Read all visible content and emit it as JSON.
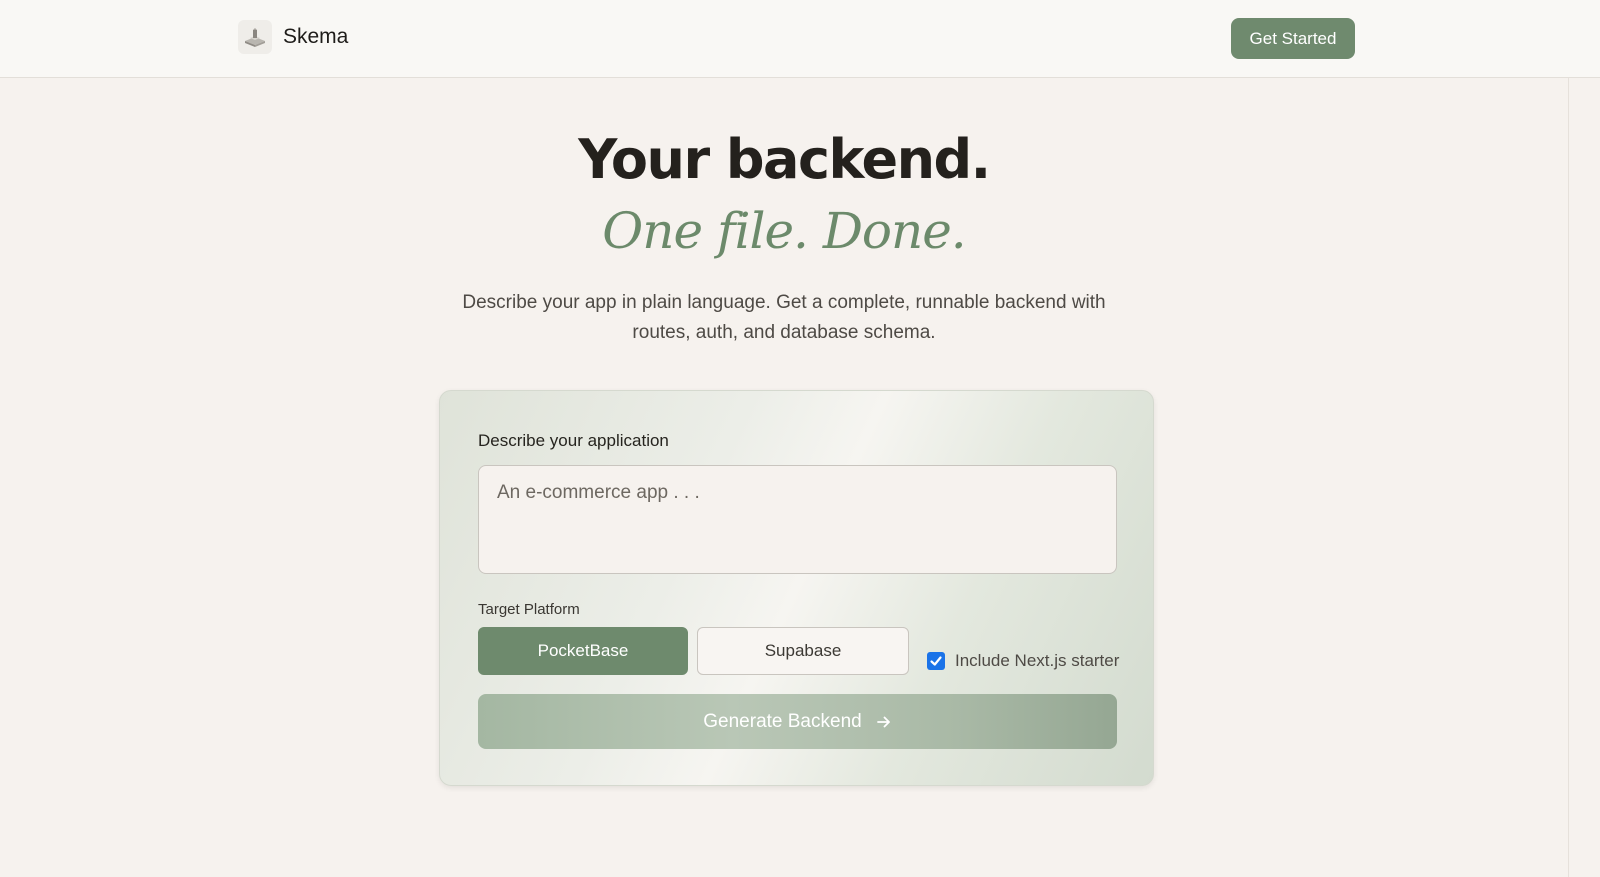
{
  "nav": {
    "brand_name": "Skema",
    "cta_label": "Get Started"
  },
  "hero": {
    "headline": "Your backend.",
    "tagline": "One file. Done.",
    "subtext": "Describe your app in plain language. Get a complete, runnable backend with routes, auth, and database schema."
  },
  "form": {
    "description_label": "Describe your application",
    "description_placeholder": "An e-commerce app . . .",
    "description_value": "",
    "platform_label": "Target Platform",
    "platforms": [
      {
        "label": "PocketBase",
        "selected": true
      },
      {
        "label": "Supabase",
        "selected": false
      }
    ],
    "nextjs_label": "Include Next.js starter",
    "nextjs_checked": true,
    "generate_label": "Generate Backend"
  },
  "colors": {
    "accent": "#6e8a6d",
    "tagline": "#6c8a6b",
    "background": "#f6f2ee",
    "checkbox": "#1a73e8"
  },
  "icons": {
    "logo": "skema-logo-icon",
    "generate": "arrow-right-icon",
    "checkbox": "checkmark-icon"
  }
}
